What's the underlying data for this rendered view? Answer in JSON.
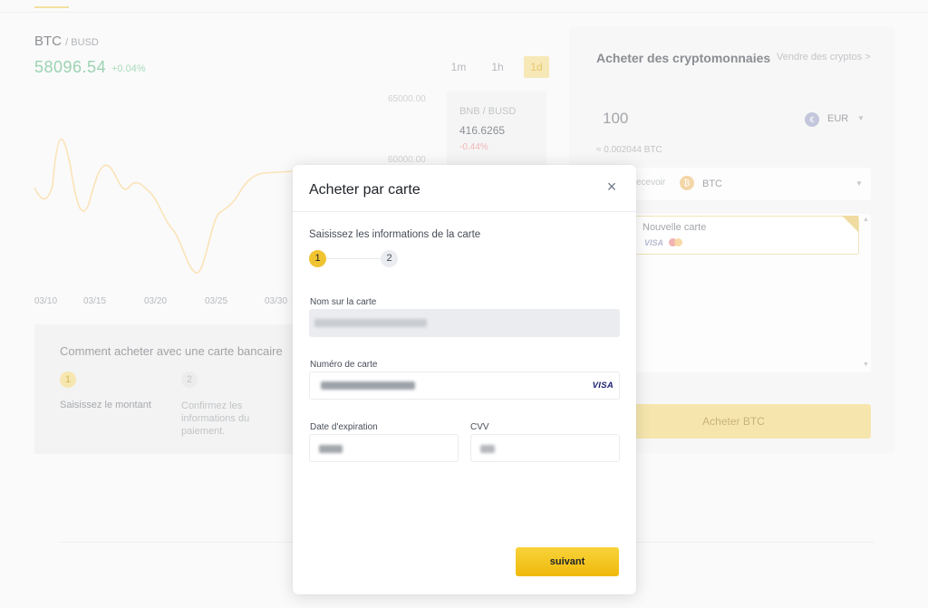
{
  "market": {
    "pair_base": "BTC",
    "pair_quote": "/ BUSD",
    "price": "58096.54",
    "change": "+0.04%",
    "timeframes": [
      "1m",
      "1h",
      "1d"
    ],
    "selected_timeframe": "1d"
  },
  "chart_data": {
    "type": "line",
    "x": [
      "03/10",
      "03/15",
      "03/20",
      "03/25",
      "03/30"
    ],
    "y_ticks": [
      "65000.00",
      "60000.00"
    ]
  },
  "ticker_card": {
    "pair": "BNB / BUSD",
    "price": "416.6265",
    "change": "-0.44%"
  },
  "how_to": {
    "title": "Comment acheter avec une carte bancaire",
    "steps": [
      {
        "num": "1",
        "label": "Saisissez le montant"
      },
      {
        "num": "2",
        "label": "Confirmez les informations du paiement."
      }
    ]
  },
  "buy_panel": {
    "title": "Acheter des cryptomonnaies",
    "sell_link": "Vendre des cryptos >",
    "amount": "100",
    "fiat": "EUR",
    "fiat_icon": "€",
    "conversion": "≈ 0.002044 BTC",
    "receive_prefix": "ecevoir",
    "crypto": "BTC",
    "crypto_icon": "₿",
    "new_card_label": "Nouvelle carte",
    "card_brand": "VISA",
    "buy_button": "Acheter BTC"
  },
  "modal": {
    "title": "Acheter par carte",
    "close_icon": "×",
    "subtitle": "Saisissez les informations de la carte",
    "steps": [
      "1",
      "2"
    ],
    "fields": {
      "name_label": "Nom sur la carte",
      "number_label": "Numéro de carte",
      "expiry_label": "Date d'expiration",
      "cvv_label": "CVV"
    },
    "card_brand": "VISA",
    "next_button": "suivant"
  },
  "colors": {
    "accent": "#f0b90b",
    "positive": "#02c076",
    "negative": "#f84960"
  }
}
